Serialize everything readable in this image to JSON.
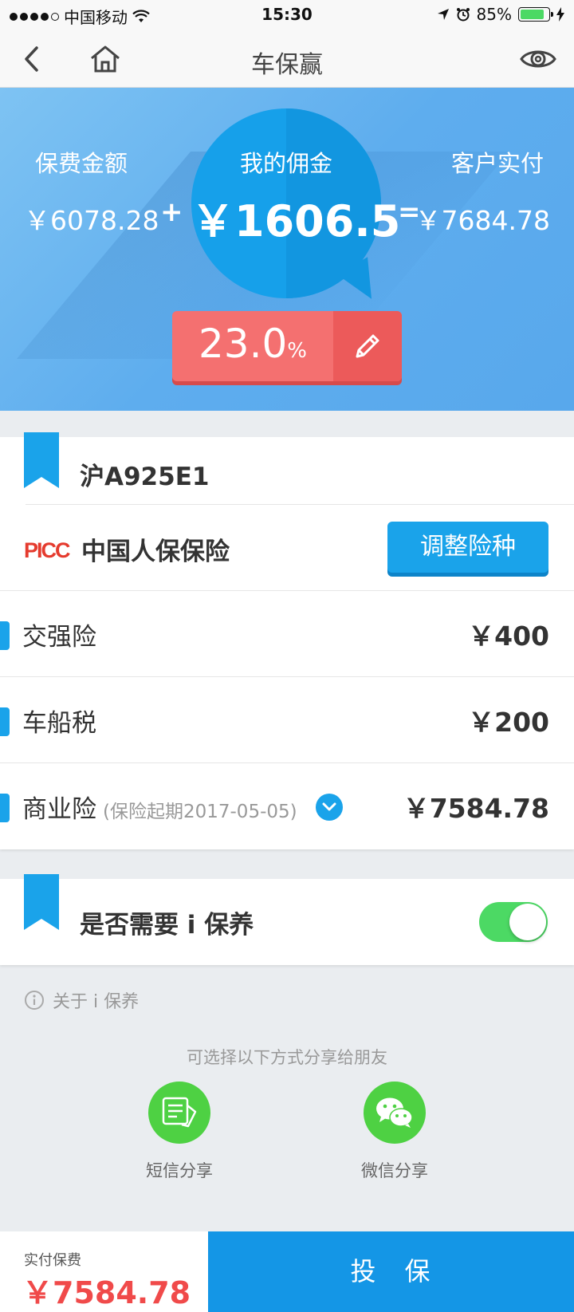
{
  "status_bar": {
    "carrier": "中国移动",
    "time": "15:30",
    "battery": "85%",
    "battery_level": 0.85
  },
  "nav": {
    "title": "车保赢",
    "back_icon": "chevron-left-icon",
    "home_icon": "home-icon",
    "eye_icon": "eye-icon"
  },
  "hero": {
    "premium_label": "保费金额",
    "premium_value": "￥6078.28",
    "plus": "+",
    "commission_label": "我的佣金",
    "commission_value": "￥1606.5",
    "equals": "=",
    "customer_pay_label": "客户实付",
    "customer_pay_value": "￥7684.78",
    "rate": "23.0",
    "rate_unit": "%"
  },
  "vehicle": {
    "plate": "沪A925E1",
    "company_logo": "PICC",
    "company_name": "中国人保保险",
    "adjust_label": "调整险种"
  },
  "insurance": [
    {
      "label": "交强险",
      "sub": "",
      "price": "￥400"
    },
    {
      "label": "车船税",
      "sub": "",
      "price": "￥200"
    },
    {
      "label": "商业险",
      "sub": "(保险起期2017-05-05)",
      "price": "￥7584.78"
    }
  ],
  "maintenance": {
    "label": "是否需要 i 保养",
    "toggle_on": true,
    "about": "关于 i 保养"
  },
  "share": {
    "hint": "可选择以下方式分享给朋友",
    "sms": "短信分享",
    "wechat": "微信分享"
  },
  "footer": {
    "pay_label": "实付保费",
    "pay_value": "￥7584.78",
    "submit": "投　保"
  },
  "colors": {
    "accent": "#1aa3ea",
    "red": "#f04a4a",
    "green": "#4cd964"
  }
}
